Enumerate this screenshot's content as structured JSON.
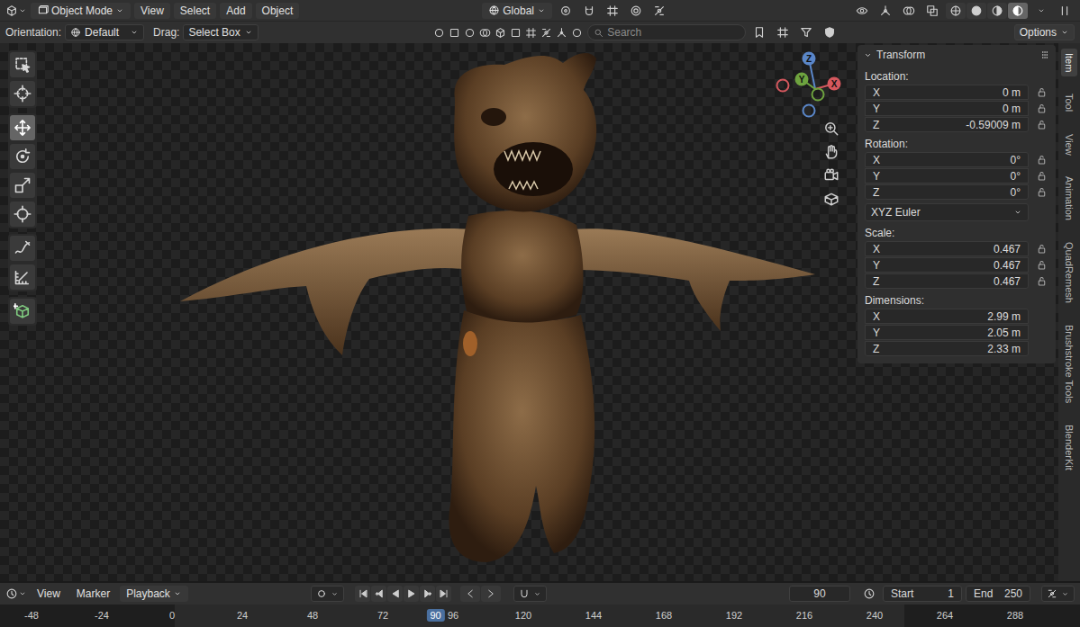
{
  "header": {
    "mode": "Object Mode",
    "menus": [
      "View",
      "Select",
      "Add",
      "Object"
    ],
    "orientation": "Global",
    "shading": [
      {
        "kind": "wireframe",
        "selected": false
      },
      {
        "kind": "solid",
        "selected": false
      },
      {
        "kind": "material",
        "selected": false
      },
      {
        "kind": "rendered",
        "selected": true
      }
    ]
  },
  "tool_header": {
    "orientation_label": "Orientation:",
    "orientation_value": "Default",
    "drag_label": "Drag:",
    "drag_value": "Select Box",
    "search": {
      "placeholder": "Search"
    },
    "options": "Options"
  },
  "toolbar": {
    "groups": [
      [
        {
          "kind": "select-box",
          "selected": false
        },
        {
          "kind": "cursor",
          "selected": false
        }
      ],
      [
        {
          "kind": "move",
          "selected": true
        },
        {
          "kind": "rotate",
          "selected": false
        },
        {
          "kind": "scale",
          "selected": false
        },
        {
          "kind": "transform",
          "selected": false
        }
      ],
      [
        {
          "kind": "annotate",
          "selected": false
        },
        {
          "kind": "measure",
          "selected": false
        }
      ],
      [
        {
          "kind": "add-cube",
          "selected": false
        }
      ]
    ]
  },
  "gizmo": {
    "axes": [
      {
        "label": "Z",
        "color": "#5a86c8"
      },
      {
        "label": "Y",
        "color": "#6ea33f"
      },
      {
        "label": "X",
        "color": "#d4585e"
      }
    ]
  },
  "transform_panel": {
    "title": "Transform",
    "sections": [
      {
        "label": "Location:",
        "fields": [
          {
            "axis": "X",
            "value": "0 m",
            "locked": false
          },
          {
            "axis": "Y",
            "value": "0 m",
            "locked": false
          },
          {
            "axis": "Z",
            "value": "-0.59009 m",
            "locked": false
          }
        ]
      },
      {
        "label": "Rotation:",
        "fields": [
          {
            "axis": "X",
            "value": "0°",
            "locked": false
          },
          {
            "axis": "Y",
            "value": "0°",
            "locked": false
          },
          {
            "axis": "Z",
            "value": "0°",
            "locked": false
          }
        ],
        "mode": "XYZ Euler"
      },
      {
        "label": "Scale:",
        "fields": [
          {
            "axis": "X",
            "value": "0.467",
            "locked": false
          },
          {
            "axis": "Y",
            "value": "0.467",
            "locked": false
          },
          {
            "axis": "Z",
            "value": "0.467",
            "locked": false
          }
        ]
      },
      {
        "label": "Dimensions:",
        "fields": [
          {
            "axis": "X",
            "value": "2.99 m"
          },
          {
            "axis": "Y",
            "value": "2.05 m"
          },
          {
            "axis": "Z",
            "value": "2.33 m"
          }
        ]
      }
    ]
  },
  "sidebar_tabs": [
    {
      "label": "Item",
      "selected": true
    },
    {
      "label": "Tool",
      "selected": false
    },
    {
      "label": "View",
      "selected": false
    },
    {
      "label": "Animation",
      "selected": false
    },
    {
      "label": "QuadRemesh",
      "selected": false
    },
    {
      "label": "Brushstroke Tools",
      "selected": false
    },
    {
      "label": "BlenderKit",
      "selected": false
    }
  ],
  "timeline": {
    "menus": [
      "View",
      "Marker"
    ],
    "playback": "Playback",
    "current_frame": "90",
    "start_label": "Start",
    "start": "1",
    "end_label": "End",
    "end": "250",
    "ruler": [
      {
        "label": "-48",
        "selected": false
      },
      {
        "label": "-24",
        "selected": false
      },
      {
        "label": "0",
        "selected": false
      },
      {
        "label": "24",
        "selected": false
      },
      {
        "label": "48",
        "selected": false
      },
      {
        "label": "72",
        "selected": false
      },
      {
        "label": "90",
        "selected": true
      },
      {
        "label": "96",
        "selected": false
      },
      {
        "label": "120",
        "selected": false
      },
      {
        "label": "144",
        "selected": false
      },
      {
        "label": "168",
        "selected": false
      },
      {
        "label": "192",
        "selected": false
      },
      {
        "label": "216",
        "selected": false
      },
      {
        "label": "240",
        "selected": false
      },
      {
        "label": "264",
        "selected": false
      },
      {
        "label": "288",
        "selected": false
      }
    ]
  }
}
